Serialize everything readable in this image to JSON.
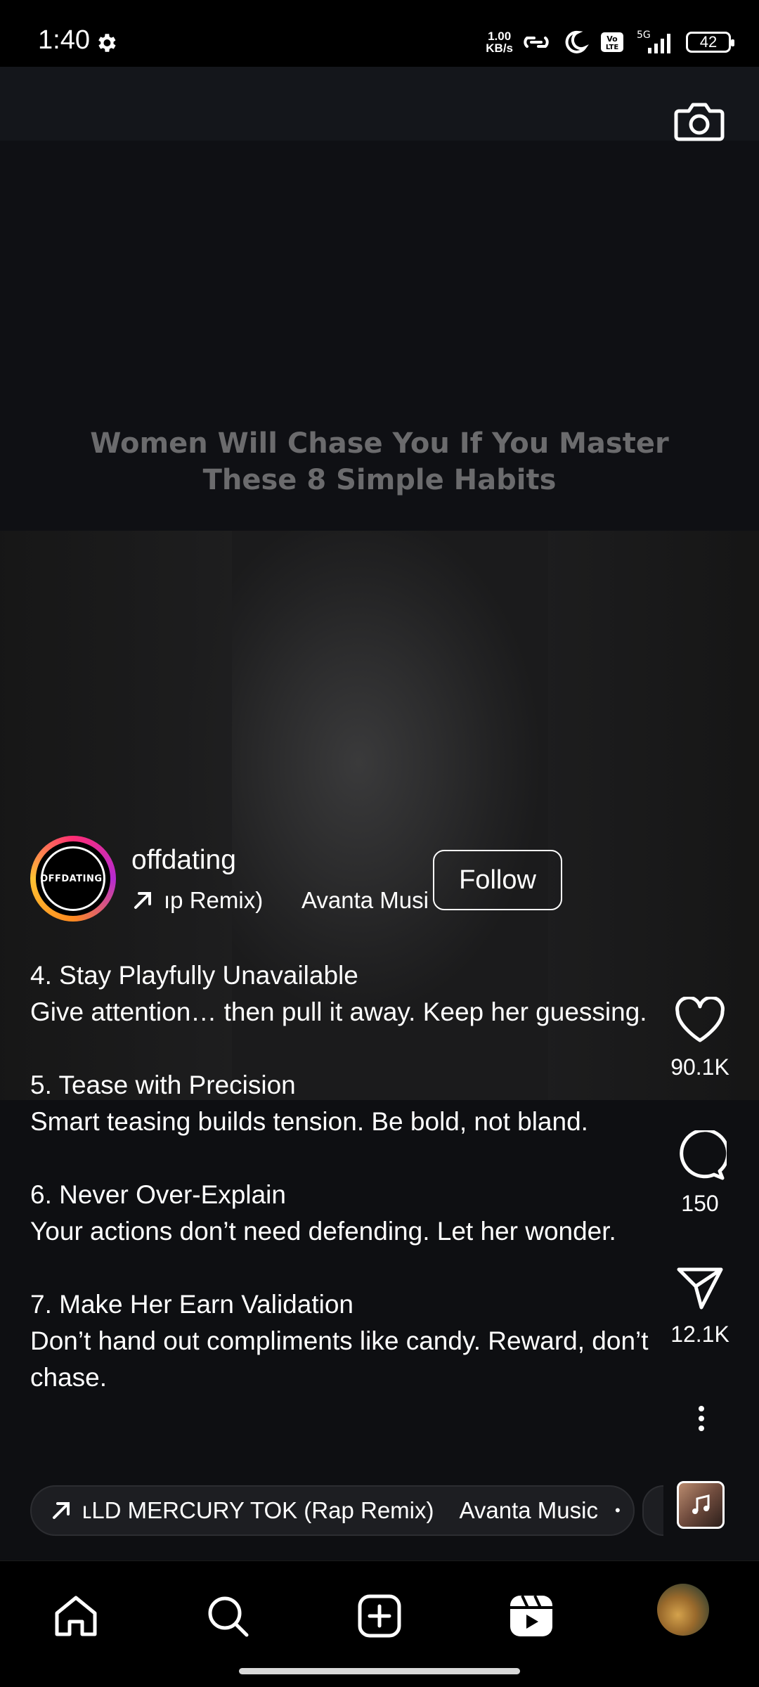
{
  "status_bar": {
    "time": "1:40",
    "net_speed_value": "1.00",
    "net_speed_unit": "KB/s",
    "volte_label": "Vo LTE",
    "network_label": "5G",
    "battery": "42",
    "icons": [
      "gear-icon",
      "hotspot-link-icon",
      "moon-icon",
      "volte-icon",
      "signal-icon",
      "battery-icon"
    ]
  },
  "video": {
    "title_line1": "Women Will Chase You If You Master",
    "title_line2": "These 8 Simple Habits"
  },
  "author": {
    "avatar_text": "OFFDATING.",
    "username": "offdating",
    "audio_track_visible": "ıp Remix)",
    "audio_artist": "Avanta Musi",
    "follow_label": "Follow"
  },
  "caption": {
    "items": [
      {
        "heading": "4. Stay Playfully Unavailable",
        "body": "Give attention… then pull it away. Keep her guessing."
      },
      {
        "heading": "5. Tease with Precision",
        "body": "Smart teasing builds tension. Be bold, not bland."
      },
      {
        "heading": "6. Never Over-Explain",
        "body": "Your actions don’t need defending. Let her wonder."
      },
      {
        "heading": "7. Make Her Earn Validation",
        "body": "Don’t hand out compliments like candy. Reward, don’t chase."
      }
    ]
  },
  "actions": {
    "likes": "90.1K",
    "comments": "150",
    "shares": "12.1K"
  },
  "music": {
    "track": "ʟLD MERCURY TOK (Rap Remix)",
    "artist": "Avanta Music",
    "dot": "•"
  },
  "bottom_nav": {
    "items": [
      "home-icon",
      "search-icon",
      "create-icon",
      "reels-icon",
      "profile-avatar"
    ]
  },
  "colors": {
    "background": "#0b0b0d",
    "title_text": "#6b6b6d",
    "ring_gradient_start": "#ff2d74",
    "ring_gradient_end": "#ffc232"
  }
}
